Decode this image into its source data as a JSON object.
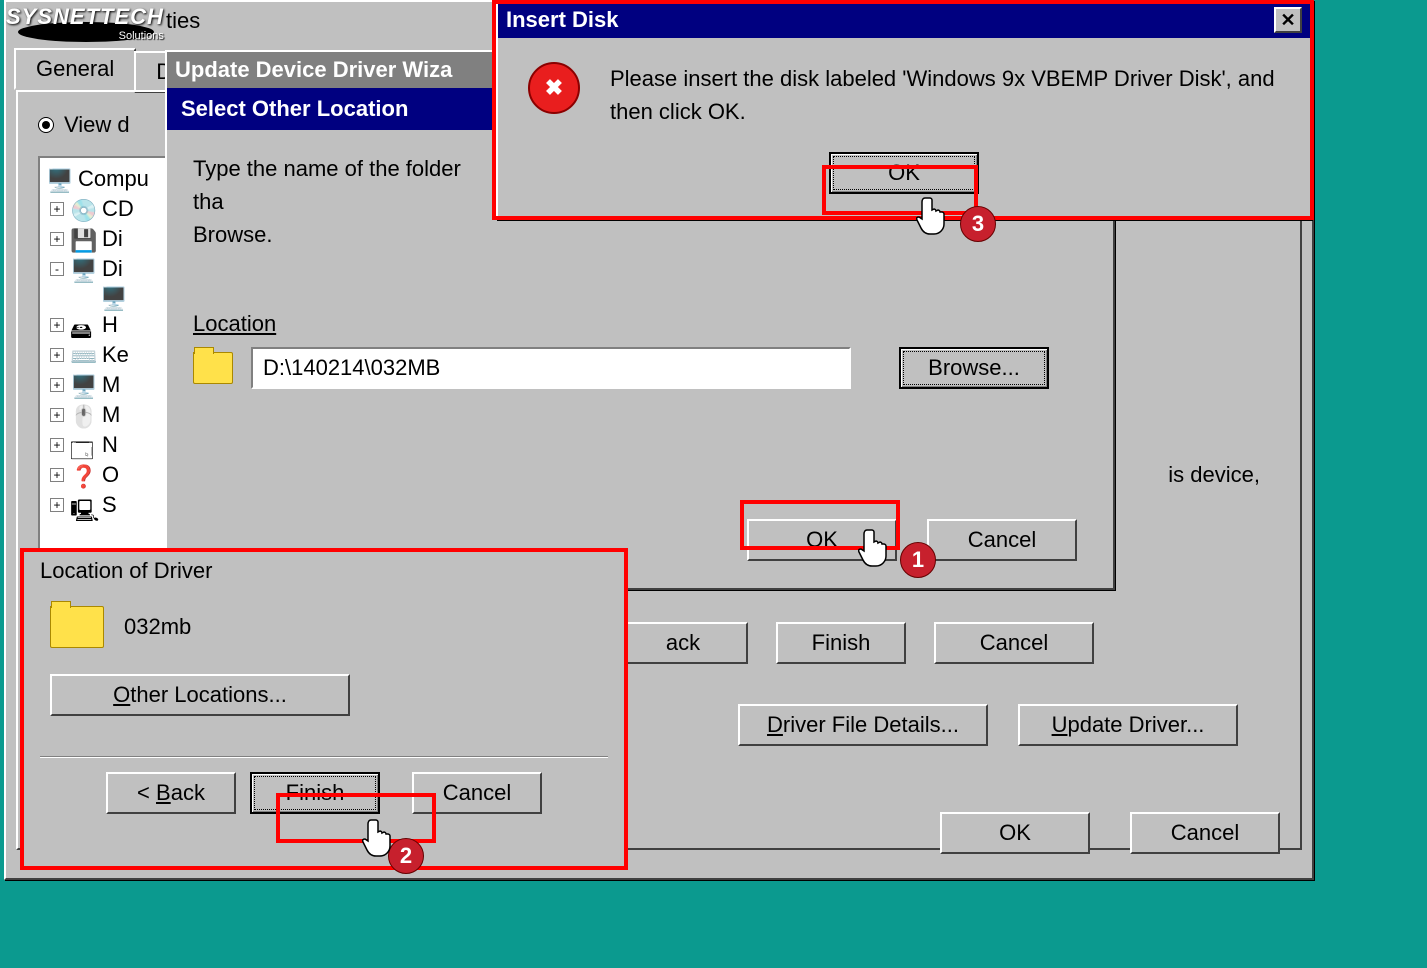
{
  "logo": {
    "line1": "SYSNETTECH",
    "line2": "Solutions"
  },
  "properties": {
    "title_suffix": "ties",
    "tabs": {
      "general": "General",
      "device": "De"
    },
    "view_label": "View d",
    "tree": {
      "root": "Compu",
      "items": [
        {
          "exp": "+",
          "icon": "cd",
          "label": "CD"
        },
        {
          "exp": "+",
          "icon": "disk",
          "label": "Di"
        },
        {
          "exp": "-",
          "icon": "display",
          "label": "Di"
        },
        {
          "exp": "",
          "icon": "display",
          "label": "",
          "indent": true
        },
        {
          "exp": "+",
          "icon": "hdd",
          "label": "H"
        },
        {
          "exp": "+",
          "icon": "kbd",
          "label": "Ke"
        },
        {
          "exp": "+",
          "icon": "display",
          "label": "M"
        },
        {
          "exp": "+",
          "icon": "mouse",
          "label": "M"
        },
        {
          "exp": "+",
          "icon": "net",
          "label": "N"
        },
        {
          "exp": "+",
          "icon": "help",
          "label": "O"
        },
        {
          "exp": "+",
          "icon": "sys",
          "label": "S"
        }
      ]
    },
    "right_text": "is device,",
    "buttons": {
      "back": "ack",
      "finish": "Finish",
      "cancel": "Cancel",
      "driver_details": "Driver File Details...",
      "update_driver": "Update Driver...",
      "ok": "OK"
    }
  },
  "wizard": {
    "title": "Update Device Driver Wiza",
    "subtitle": "Select Other Location",
    "instruction": "Type the name of the folder tha Browse.",
    "location_label": "Location",
    "location_value": "D:\\140214\\032MB",
    "browse": "Browse...",
    "ok": "OK",
    "cancel": "Cancel"
  },
  "driver_loc": {
    "title": "Location of Driver",
    "folder": "032mb",
    "other": "Other Locations...",
    "back": "< Back",
    "finish": "Finish",
    "cancel": "Cancel"
  },
  "insert_disk": {
    "title": "Insert Disk",
    "message": "Please insert the disk labeled 'Windows 9x VBEMP Driver Disk', and then click OK.",
    "ok": "OK"
  },
  "annotations": {
    "n1": "1",
    "n2": "2",
    "n3": "3"
  }
}
